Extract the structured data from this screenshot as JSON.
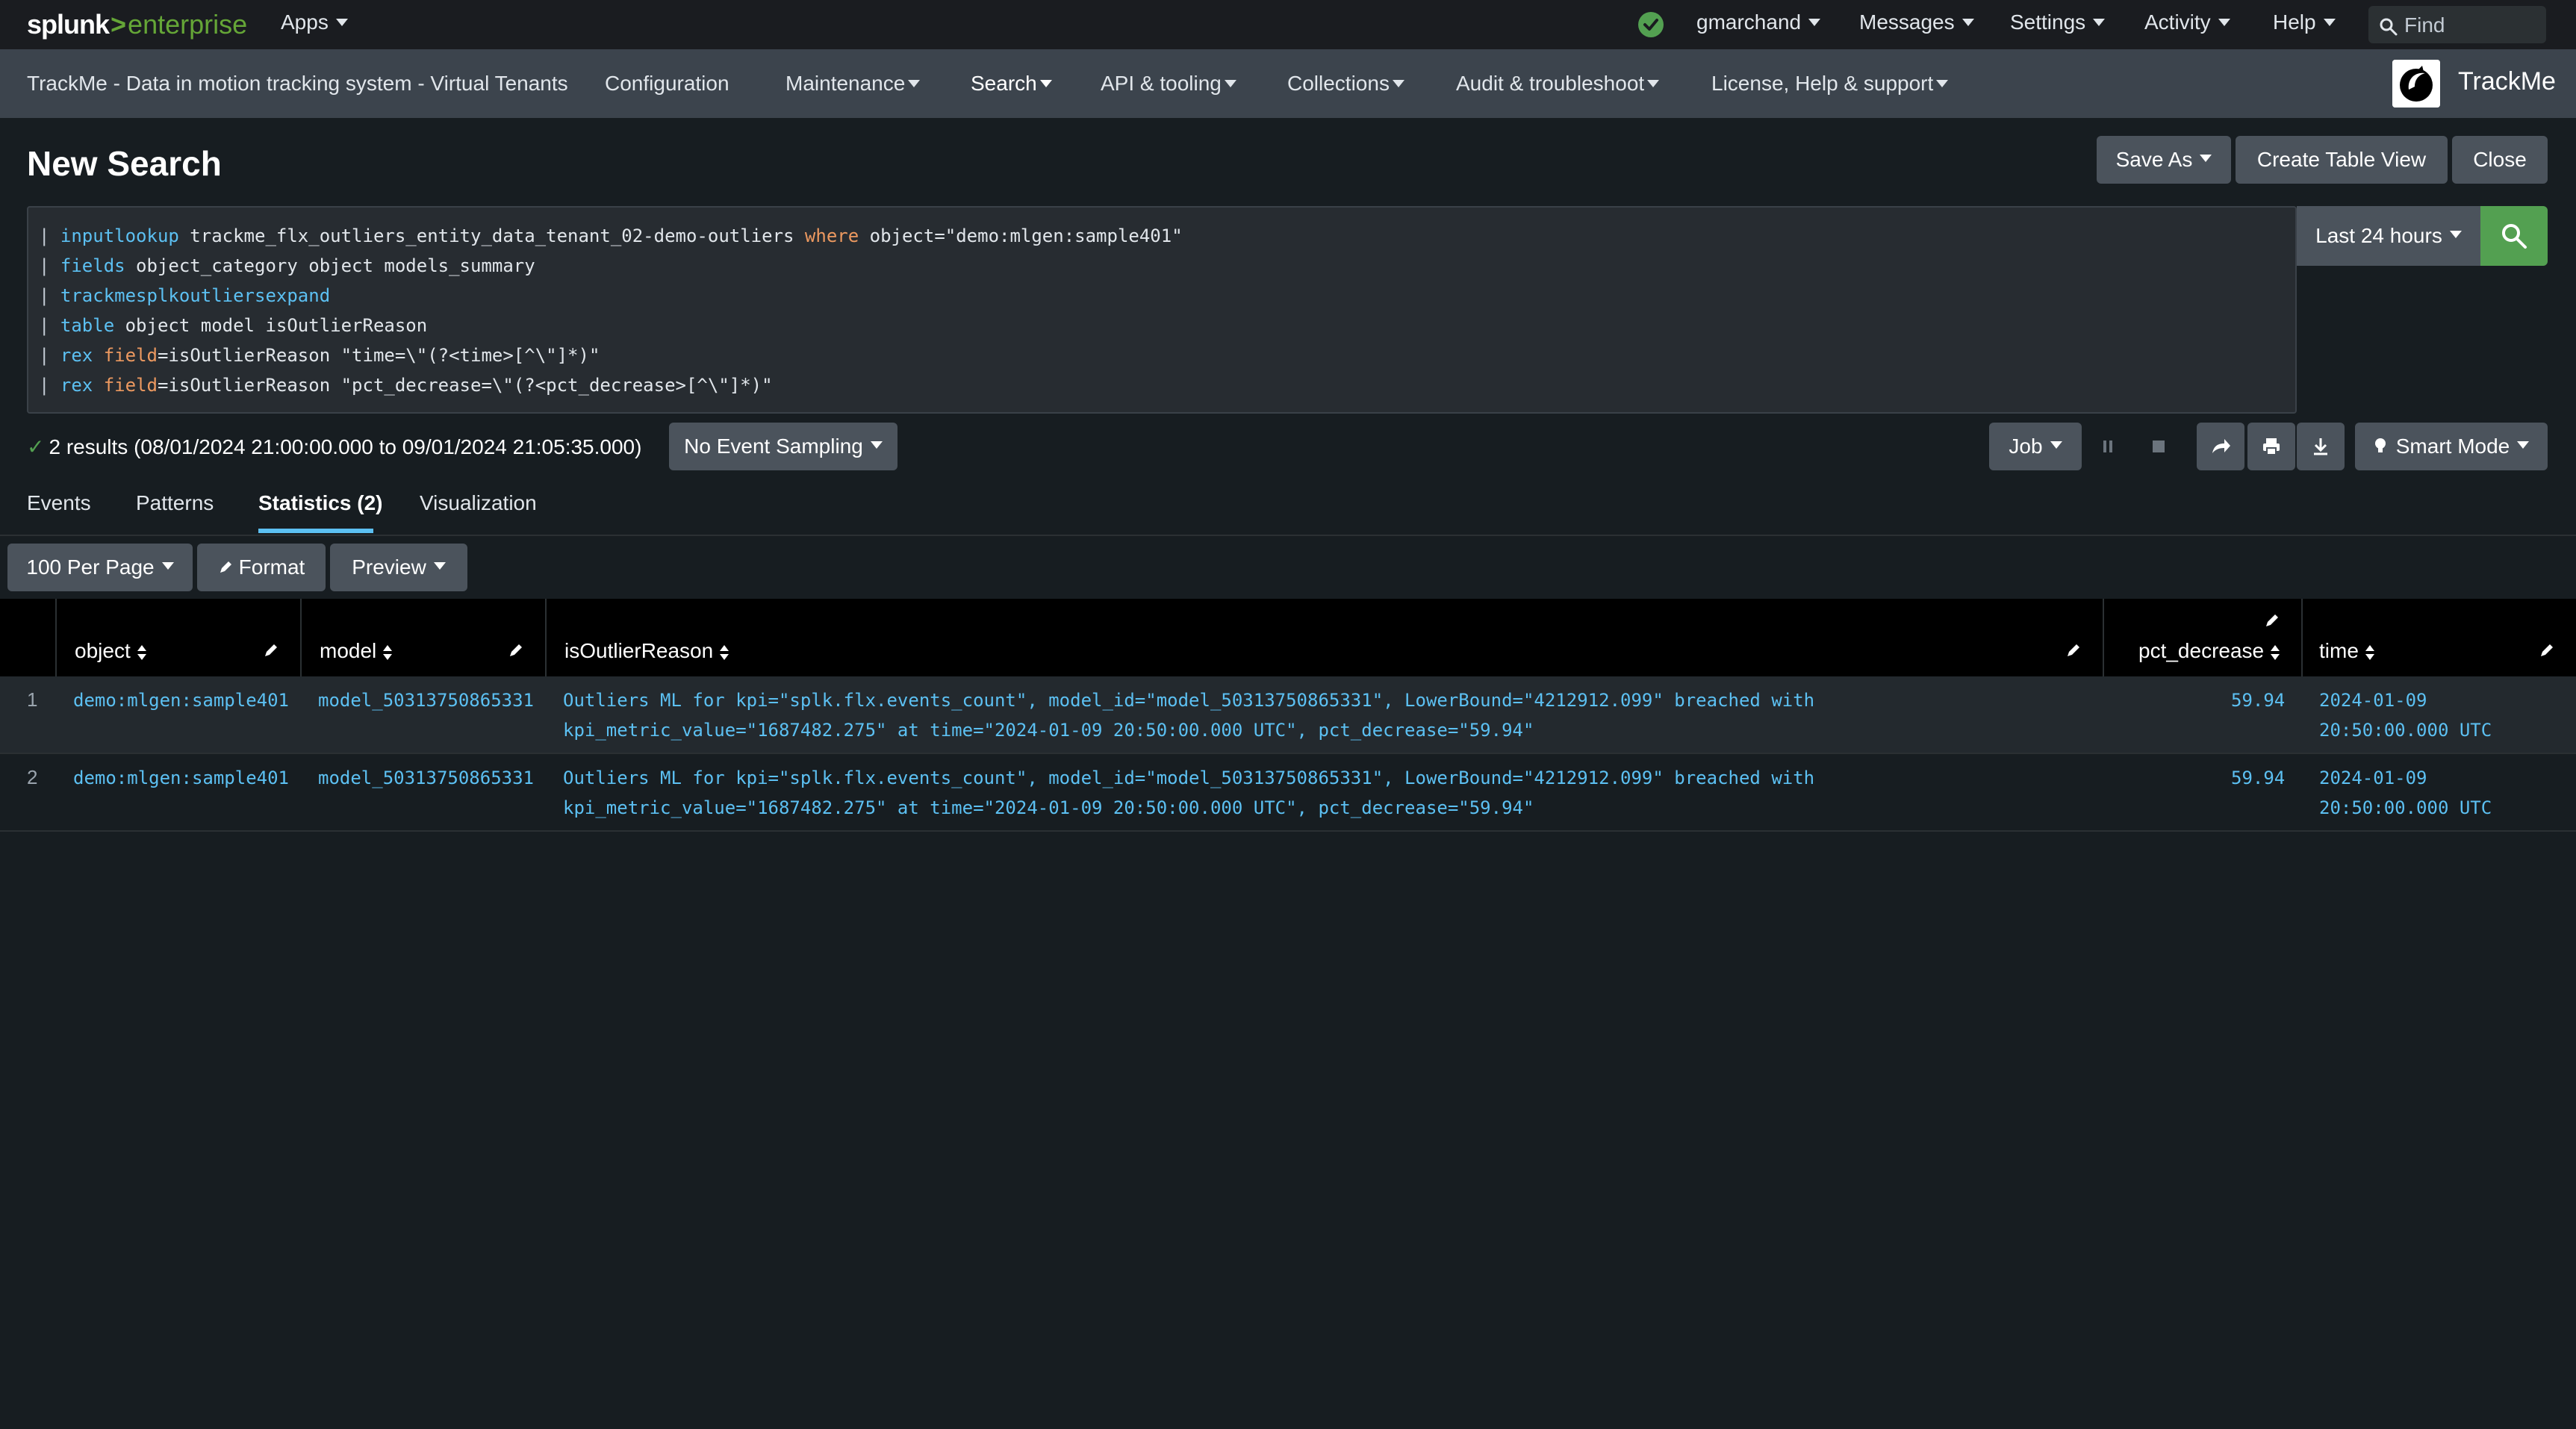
{
  "topbar": {
    "logo_splunk": "splunk",
    "logo_gt": ">",
    "logo_enterprise": "enterprise",
    "apps": "Apps",
    "user": "gmarchand",
    "messages": "Messages",
    "settings": "Settings",
    "activity": "Activity",
    "help": "Help",
    "find_placeholder": "Find"
  },
  "appbar": {
    "title": "TrackMe - Data in motion tracking system - Virtual Tenants",
    "items": [
      "Configuration",
      "Maintenance",
      "Search",
      "API & tooling",
      "Collections",
      "Audit & troubleshoot",
      "License, Help & support"
    ],
    "brand": "TrackMe"
  },
  "page": {
    "title": "New Search",
    "save_as": "Save As",
    "create_table_view": "Create Table View",
    "close": "Close"
  },
  "search": {
    "lines": [
      {
        "pipe": "|",
        "cmd": "inputlookup",
        "a": " trackme_flx_outliers_entity_data_tenant_02-demo-outliers ",
        "kw2": "where",
        "b": " object=\"demo:mlgen:sample401\""
      },
      {
        "pipe": "|",
        "cmd": "fields",
        "a": " object_category object models_summary",
        "kw2": "",
        "b": ""
      },
      {
        "pipe": "|",
        "cmd": "trackmesplkoutliersexpand",
        "a": "",
        "kw2": "",
        "b": ""
      },
      {
        "pipe": "|",
        "cmd": "table",
        "a": " object model isOutlierReason",
        "kw2": "",
        "b": ""
      },
      {
        "pipe": "|",
        "cmd": "rex",
        "a": " ",
        "kw2": "field",
        "b": "=isOutlierReason \"time=\\\"(?<time>[^\\\"]*)\""
      },
      {
        "pipe": "|",
        "cmd": "rex",
        "a": " ",
        "kw2": "field",
        "b": "=isOutlierReason \"pct_decrease=\\\"(?<pct_decrease>[^\\\"]*)\""
      }
    ],
    "time_range": "Last 24 hours"
  },
  "results": {
    "check": "✓",
    "summary": "2 results (08/01/2024 21:00:00.000 to 09/01/2024 21:05:35.000)",
    "sampling": "No Event Sampling",
    "job": "Job",
    "smart_mode": "Smart Mode"
  },
  "tabs": [
    "Events",
    "Patterns",
    "Statistics (2)",
    "Visualization"
  ],
  "table_controls": {
    "per_page": "100 Per Page",
    "format": "Format",
    "preview": "Preview"
  },
  "table": {
    "columns": [
      "object",
      "model",
      "isOutlierReason",
      "pct_decrease",
      "time"
    ],
    "rows": [
      {
        "num": "1",
        "object": "demo:mlgen:sample401",
        "model": "model_50313750865331",
        "reason_line1": "Outliers ML for kpi=\"splk.flx.events_count\", model_id=\"model_50313750865331\", LowerBound=\"4212912.099\" breached with",
        "reason_line2": "kpi_metric_value=\"1687482.275\" at time=\"2024-01-09 20:50:00.000 UTC\", pct_decrease=\"59.94\"",
        "pct_decrease": "59.94",
        "time_line1": "2024-01-09",
        "time_line2": "20:50:00.000 UTC"
      },
      {
        "num": "2",
        "object": "demo:mlgen:sample401",
        "model": "model_50313750865331",
        "reason_line1": "Outliers ML for kpi=\"splk.flx.events_count\", model_id=\"model_50313750865331\", LowerBound=\"4212912.099\" breached with",
        "reason_line2": "kpi_metric_value=\"1687482.275\" at time=\"2024-01-09 20:50:00.000 UTC\", pct_decrease=\"59.94\"",
        "pct_decrease": "59.94",
        "time_line1": "2024-01-09",
        "time_line2": "20:50:00.000 UTC"
      }
    ]
  },
  "colors": {
    "accent_blue": "#5cc0f2",
    "success_green": "#53a051",
    "keyword_orange": "#ec9960"
  }
}
